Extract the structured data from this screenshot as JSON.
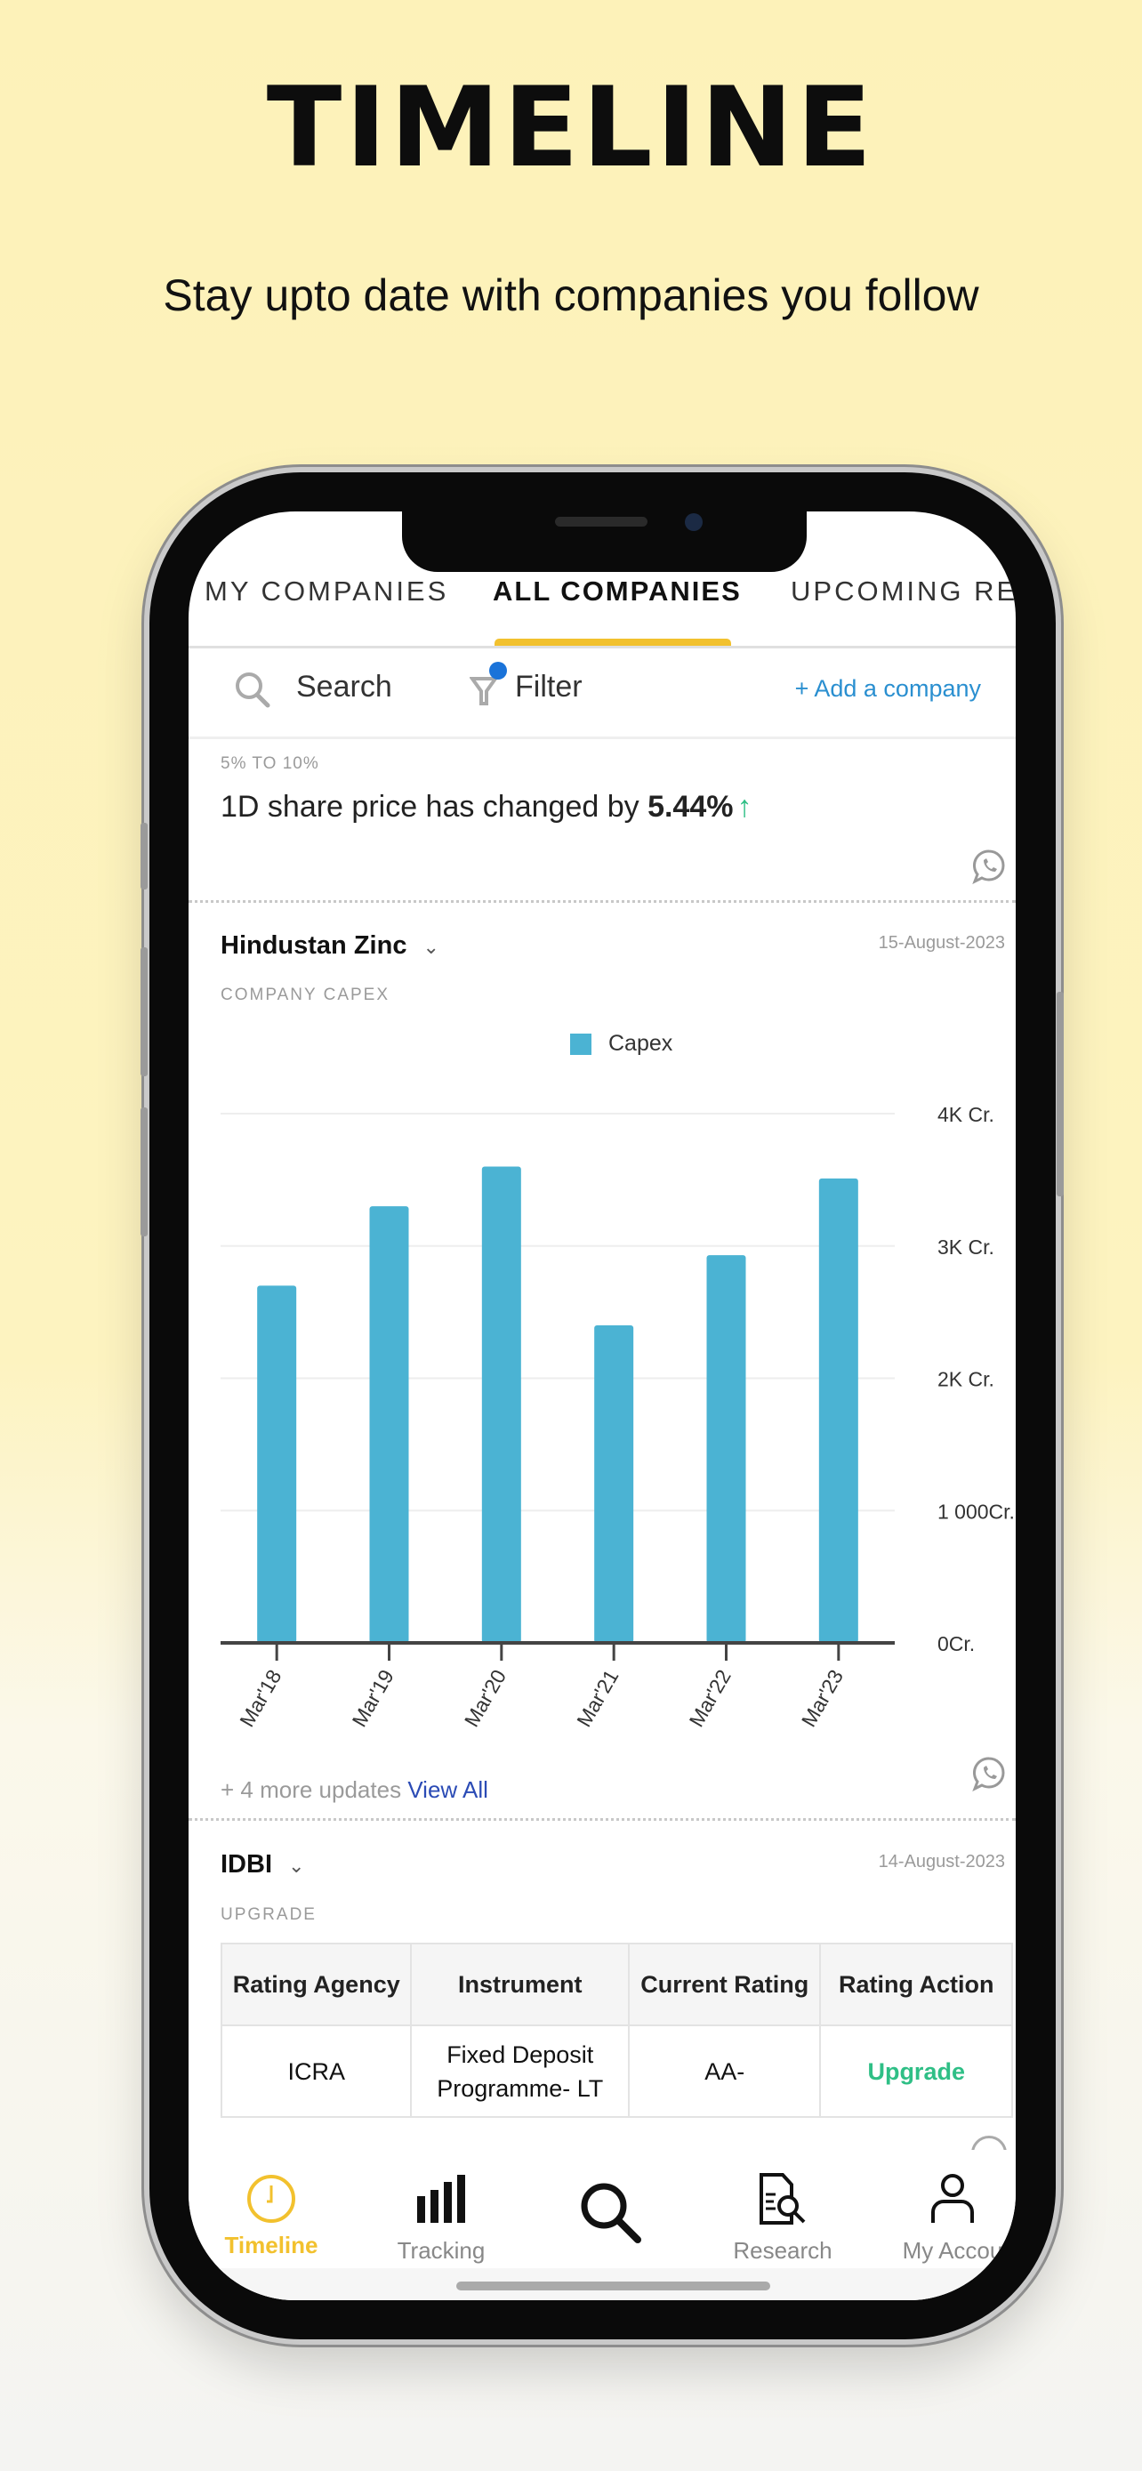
{
  "promo": {
    "title": "TIMELINE",
    "subtitle": "Stay upto date with companies you follow"
  },
  "tabs": [
    {
      "label": "MY COMPANIES"
    },
    {
      "label": "ALL COMPANIES",
      "active": true
    },
    {
      "label": "UPCOMING RE"
    }
  ],
  "toolbar": {
    "search": "Search",
    "filter": "Filter",
    "add": "+ Add a company",
    "search_icon": "search-icon",
    "filter_icon": "filter-icon"
  },
  "price_card": {
    "range": "5% TO 10%",
    "text": "1D share price has changed by ",
    "value": "5.44%",
    "direction": "up",
    "icon": "whatsapp-icon"
  },
  "capex_card": {
    "company": "Hindustan Zinc",
    "date": "15-August-2023",
    "category": "COMPANY CAPEX",
    "more": "+ 4 more updates ",
    "view_all": "View All"
  },
  "chart_data": {
    "type": "bar",
    "categories": [
      "Mar'18",
      "Mar'19",
      "Mar'20",
      "Mar'21",
      "Mar'22",
      "Mar'23"
    ],
    "series": [
      {
        "name": "Capex",
        "values": [
          2700,
          3300,
          3600,
          2400,
          2930,
          3510
        ]
      }
    ],
    "ylim": [
      0,
      4000
    ],
    "yticks": [
      0,
      1000,
      2000,
      3000,
      4000
    ],
    "ytick_labels": [
      "0Cr.",
      "1 000Cr.",
      "2K Cr.",
      "3K Cr.",
      "4K Cr."
    ],
    "legend": "top",
    "grid": true,
    "color": "#4bb3d3",
    "yaxis_side": "right"
  },
  "rating_card": {
    "company": "IDBI",
    "date": "14-August-2023",
    "category": "UPGRADE",
    "headers": [
      "Rating Agency",
      "Instrument",
      "Current Rating",
      "Rating Action"
    ],
    "rows": [
      [
        "ICRA",
        "Fixed Deposit Programme- LT",
        "AA-",
        "Upgrade"
      ]
    ]
  },
  "nav": [
    {
      "label": "Timeline",
      "icon": "clock-icon",
      "active": true
    },
    {
      "label": "Tracking",
      "icon": "bar-chart-icon"
    },
    {
      "label": "",
      "icon": "search-icon"
    },
    {
      "label": "Research",
      "icon": "research-document-icon"
    },
    {
      "label": "My Accou",
      "icon": "user-icon"
    }
  ],
  "colors": {
    "accent": "#f2c12e",
    "bar": "#4bb3d3",
    "up": "#2fbf86",
    "link": "#2a8fd0",
    "view_all": "#2b4bb5"
  }
}
